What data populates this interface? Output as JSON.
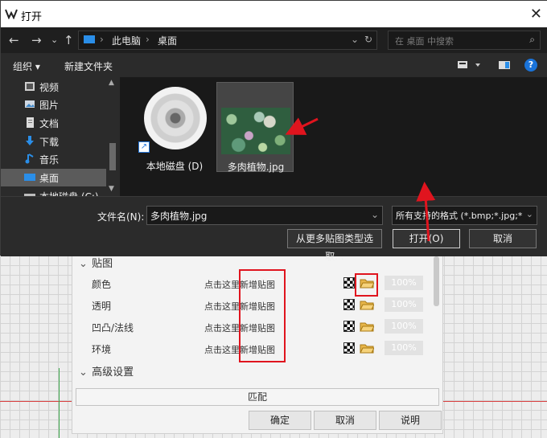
{
  "dialog": {
    "title": "打开",
    "close_glyph": "✕",
    "nav": {
      "back": "←",
      "forward": "→",
      "recent": "⌄",
      "up": "↑"
    },
    "breadcrumb": [
      "此电脑",
      "桌面"
    ],
    "breadcrumb_sep": "›",
    "refresh_glyph": "↻",
    "dropdown_glyph": "⌄",
    "search_placeholder": "在 桌面 中搜索",
    "search_glyph": "⌕",
    "toolbar": {
      "organize": "组织 ▾",
      "new_folder": "新建文件夹",
      "help": "?"
    },
    "nav_items": [
      {
        "label": "视频",
        "icon": "video-icon"
      },
      {
        "label": "图片",
        "icon": "pictures-icon"
      },
      {
        "label": "文档",
        "icon": "documents-icon"
      },
      {
        "label": "下载",
        "icon": "downloads-icon"
      },
      {
        "label": "音乐",
        "icon": "music-icon"
      },
      {
        "label": "桌面",
        "icon": "desktop-icon",
        "selected": true
      },
      {
        "label": "本地磁盘 (C:)",
        "icon": "drive-icon"
      }
    ],
    "files": [
      {
        "label": "本地磁盘 (D)",
        "icon": "disc-drive-icon",
        "selected": false
      },
      {
        "label": "多肉植物.jpg",
        "icon": "image-thumbnail",
        "selected": true
      }
    ],
    "filename_label": "文件名(N):",
    "filename_value": "多肉植物.jpg",
    "filetype_value": "所有支持的格式 (*.bmp;*.jpg;*",
    "more_types_button": "从更多贴图类型选取...",
    "open_button": "打开(O)",
    "cancel_button": "取消"
  },
  "panel": {
    "section_texture": "贴图",
    "section_advanced": "高级设置",
    "chevron": "⌄",
    "rows": [
      {
        "name": "颜色",
        "add_text": "点击这里新增贴图",
        "percent": "100%"
      },
      {
        "name": "透明",
        "add_text": "点击这里新增贴图",
        "percent": "100%"
      },
      {
        "name": "凹凸/法线",
        "add_text": "点击这里新增贴图",
        "percent": "100%"
      },
      {
        "name": "环境",
        "add_text": "点击这里新增贴图",
        "percent": "100%"
      }
    ],
    "match_button": "匹配",
    "ok_button": "确定",
    "cancel_button": "取消",
    "help_button": "说明"
  },
  "colors": {
    "annotation": "#e0141e",
    "accent": "#1a73d9",
    "dialog_bg": "#2b2b2b"
  }
}
